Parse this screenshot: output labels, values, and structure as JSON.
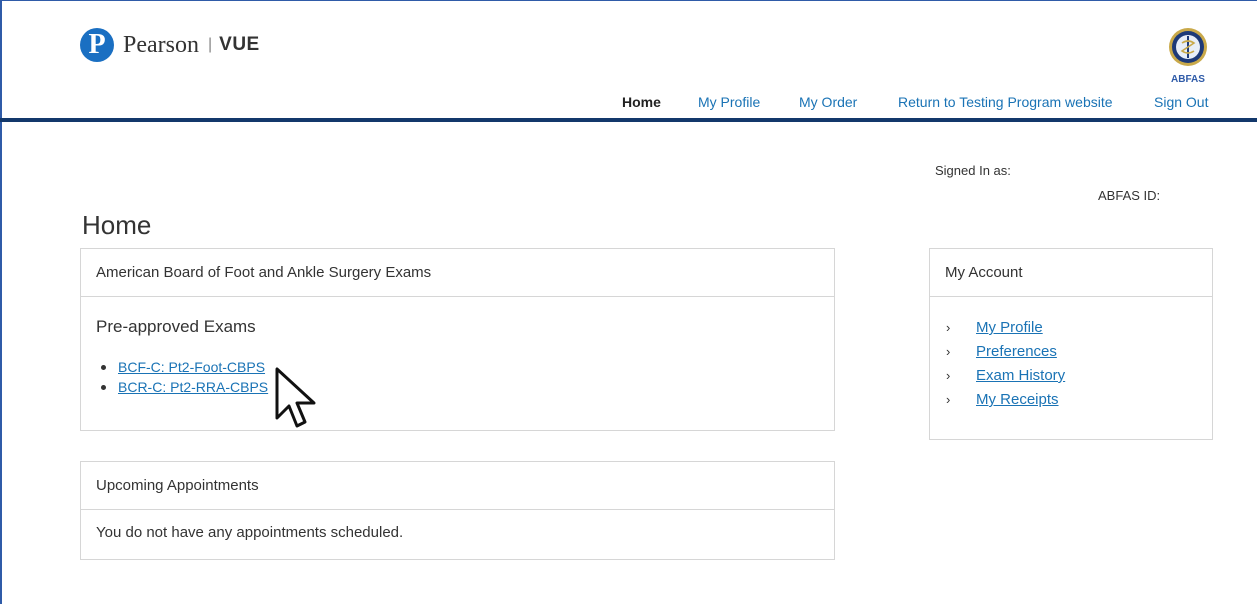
{
  "brand": {
    "mark": "P",
    "name": "Pearson",
    "separator": "|",
    "product": "VUE",
    "program_logo_label": "ABFAS"
  },
  "nav": [
    {
      "label": "Home",
      "active": true
    },
    {
      "label": "My Profile",
      "active": false
    },
    {
      "label": "My Order",
      "active": false
    },
    {
      "label": "Return to Testing Program website",
      "active": false
    },
    {
      "label": "Sign Out",
      "active": false
    }
  ],
  "user": {
    "signed_in_label": "Signed In as:",
    "id_label": "ABFAS ID:"
  },
  "page": {
    "title": "Home"
  },
  "exams_panel": {
    "header": "American Board of Foot and Ankle Surgery Exams",
    "subtitle": "Pre-approved Exams",
    "items": [
      "BCF-C: Pt2-Foot-CBPS",
      "BCR-C: Pt2-RRA-CBPS"
    ]
  },
  "appointments_panel": {
    "header": "Upcoming Appointments",
    "empty_message": "You do not have any appointments scheduled."
  },
  "account_panel": {
    "header": "My Account",
    "links": [
      "My Profile",
      "Preferences",
      "Exam History",
      "My Receipts"
    ]
  },
  "colors": {
    "link": "#1a73b5",
    "rule": "#13386b",
    "brand_blue": "#1a6fc2"
  }
}
